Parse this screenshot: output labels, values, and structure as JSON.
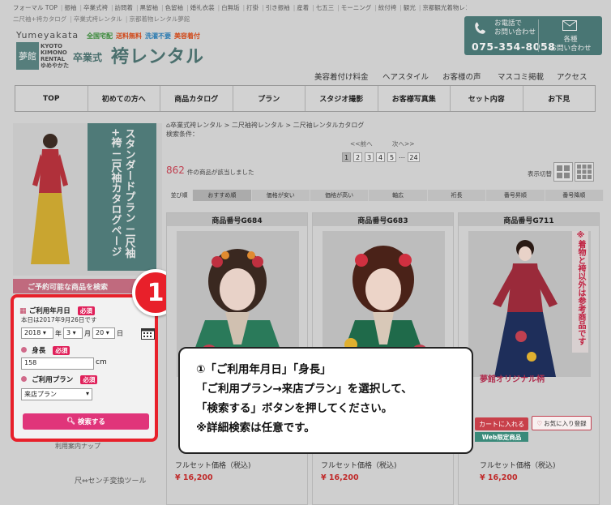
{
  "top_links_1": [
    "フォーマル TOP",
    "振袖",
    "卒業式袴",
    "訪問着",
    "黒留袖",
    "色留袖",
    "婚礼衣装",
    "白無垢",
    "打掛",
    "引き振袖",
    "産着",
    "七五三",
    "モーニング",
    "紋付袴",
    "観光",
    "京都観光着物レンタル",
    "浴衣レンタル",
    "舞妓体験",
    "美容",
    "夢館Beauty",
    "総合",
    "夢館総合"
  ],
  "top_links_2": [
    "二尺袖+袴カタログ",
    "卒業式袴レンタル",
    "京都着物レンタル夢館"
  ],
  "brand": {
    "name_en": "Yumeyakata",
    "tags": [
      {
        "text": "全国宅配",
        "color": "#3c8a3c"
      },
      {
        "text": "送料無料",
        "color": "#d04a1a"
      },
      {
        "text": "洗濯不要",
        "color": "#2a7ab0"
      },
      {
        "text": "美容着付",
        "color": "#d04a1a"
      }
    ],
    "logo_glyph": "夢館",
    "kimono_lines": [
      "KYOTO",
      "KIMONO",
      "RENTAL",
      "ゆめやかた"
    ],
    "title_small": "卒業式",
    "title": "袴レンタル"
  },
  "contact": {
    "phone_label": "お電話で\nお問い合わせ",
    "phone_number": "075-354-8058",
    "mail_label": "各種\nお問い合わせ",
    "phone_icon": "phone-icon",
    "mail_icon": "mail-icon"
  },
  "sub_nav": [
    "美容着付け料金",
    "ヘアスタイル",
    "お客様の声",
    "マスコミ掲載",
    "アクセス"
  ],
  "main_nav": [
    "TOP",
    "初めての方へ",
    "商品カタログ",
    "プラン",
    "スタジオ撮影",
    "お客様写真集",
    "セット内容",
    "お下見"
  ],
  "banner": {
    "text": "スタンダードプラン 二尺袖+袴 二尺袖カタログページ"
  },
  "availability_label": "ご予約可能な商品を検索",
  "form": {
    "date_label": "ご利用年月日",
    "required": "必須",
    "today": "本日は2017年9月26日です",
    "year": "2018",
    "year_unit": "年",
    "month": "3",
    "month_unit": "月",
    "day": "20",
    "day_unit": "日",
    "height_label": "身長",
    "height_value": "158",
    "height_unit": "cm",
    "plan_label": "ご利用プラン",
    "plan_value": "来店プラン",
    "search_button": "検索する"
  },
  "badge_number": "1",
  "below_form": "利用案内ナップ",
  "conversion_link": "尺⇔センチ変換ツール",
  "breadcrumb": "卒業式袴レンタル > 二尺袖袴レンタル > 二尺袖レンタルカタログ",
  "search_cond": "検索条件：",
  "pager": {
    "prev": "<<前へ",
    "next": "次へ>>",
    "pages": [
      "1",
      "2",
      "3",
      "4",
      "5",
      "…",
      "24"
    ]
  },
  "result_count": "862",
  "result_suffix": "件の商品が該当しました",
  "view_label": "表示切替",
  "sort": [
    "並び順",
    "おすすめ順",
    "価格が安い",
    "価格が高い",
    "軸広",
    "裄長",
    "番号昇順",
    "番号降順"
  ],
  "cards": [
    {
      "head": "商品番号G684",
      "price_label": "フルセット価格（税込)",
      "price": "¥ 16,200"
    },
    {
      "head": "商品番号G683",
      "price_label": "フルセット価格（税込)",
      "price": "¥ 16,200"
    },
    {
      "head": "商品番号G711",
      "price_label": "フルセット価格（税込)",
      "price": "¥ 16,200",
      "brand_label": "夢館オリジナル柄",
      "cart": "カートに入れる",
      "fav": "お気に入り登録",
      "web_limited": "Web限定商品",
      "side_text": "※着物と袴以外は参考商品です"
    }
  ],
  "note_lines": [
    "①「ご利用年月日」「身長」",
    "「ご利用プラン→来店プラン」を選択して、",
    "「検索する」ボタンを押してください。",
    "※詳細検索は任意です。"
  ]
}
